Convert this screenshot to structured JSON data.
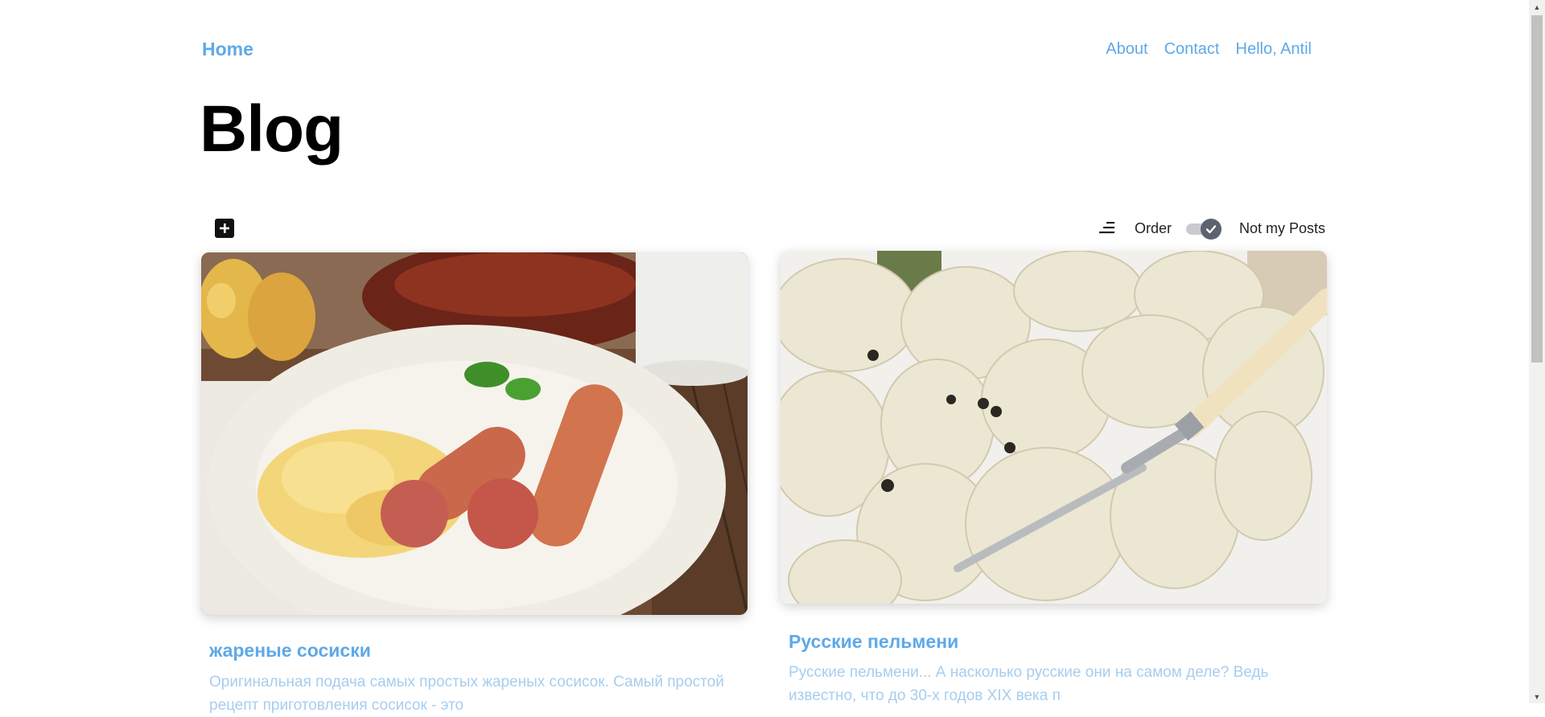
{
  "header": {
    "home_label": "Home",
    "nav": [
      {
        "label": "About"
      },
      {
        "label": "Contact"
      },
      {
        "label": "Hello, Antil"
      }
    ]
  },
  "page": {
    "title": "Blog"
  },
  "toolbar": {
    "add_icon": "plus-square-icon",
    "sort_icon": "sort-lines-icon",
    "order_label": "Order",
    "toggle_on": true,
    "not_my_posts_label": "Not my Posts"
  },
  "posts": [
    {
      "title": "жареные сосиски",
      "excerpt": "Оригинальная подача самых простых жареных сосисок. Самый простой рецепт приготовления сосисок - это",
      "image": "fried-sausages-with-pasta-photo"
    },
    {
      "title": "Русские пельмени",
      "excerpt": "Русские пельмени... А насколько русские они на самом деле? Ведь известно, что до 30-х годов XIX века п",
      "image": "russian-dumplings-photo"
    }
  ],
  "colors": {
    "link": "#5ea9e8",
    "excerpt": "#a7cdef",
    "toggle_knob": "#5b6270"
  }
}
